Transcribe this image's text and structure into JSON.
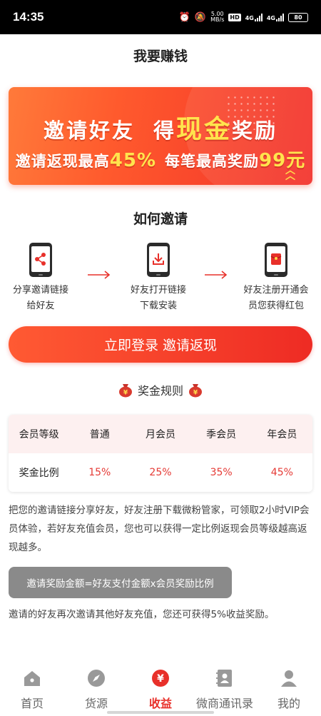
{
  "status_bar": {
    "time": "14:35",
    "speed_top": "5.00",
    "speed_unit": "MB/s",
    "hd_label": "HD",
    "net1": "4G",
    "net2": "4G",
    "battery": "80",
    "icons": [
      "alarm-icon",
      "mute-icon",
      "signal-icon",
      "battery-icon"
    ]
  },
  "header": {
    "title": "我要赚钱"
  },
  "banner": {
    "line1_prefix": "邀请好友",
    "line1_mid": "得",
    "line1_highlight": "现金",
    "line1_suffix": "奖励",
    "line2_prefix": "邀请返现最高",
    "line2_pct": "45%",
    "line2_mid": "每笔最高奖励",
    "line2_amount": "99元"
  },
  "how": {
    "title": "如何邀请",
    "steps": [
      {
        "line1": "分享邀请链接",
        "line2": "给好友",
        "icon": "share-icon"
      },
      {
        "line1": "好友打开链接",
        "line2": "下载安装",
        "icon": "download-icon"
      },
      {
        "line1": "好友注册开通会",
        "line2": "员您获得红包",
        "icon": "red-envelope-icon"
      }
    ]
  },
  "cta": {
    "label": "立即登录 邀请返现"
  },
  "rules": {
    "title": "奖金规则",
    "table": {
      "header_label": "会员等级",
      "columns": [
        "普通",
        "月会员",
        "季会员",
        "年会员"
      ],
      "row_label": "奖金比例",
      "values": [
        "15%",
        "25%",
        "35%",
        "45%"
      ]
    }
  },
  "description": {
    "text": "把您的邀请链接分享好友，好友注册下载微粉管家，可领取2小时VIP会员体验，若好友充值会员，您也可以获得一定比例返现会员等级越高返现越多。",
    "formula": "邀请奖励金额=好友支付金额x会员奖励比例",
    "text2": "邀请的好友再次邀请其他好友充值，您还可获得5%收益奖励。"
  },
  "nav": {
    "items": [
      {
        "label": "首页",
        "icon": "home-icon"
      },
      {
        "label": "货源",
        "icon": "compass-icon"
      },
      {
        "label": "收益",
        "icon": "yen-icon",
        "active": true
      },
      {
        "label": "微商通讯录",
        "icon": "contacts-icon"
      },
      {
        "label": "我的",
        "icon": "profile-icon"
      }
    ]
  },
  "colors": {
    "accent": "#e8302a",
    "banner_start": "#ff7a3a",
    "banner_end": "#f2302a",
    "highlight": "#ffe44d",
    "formula_bg": "#8a8a8a"
  }
}
